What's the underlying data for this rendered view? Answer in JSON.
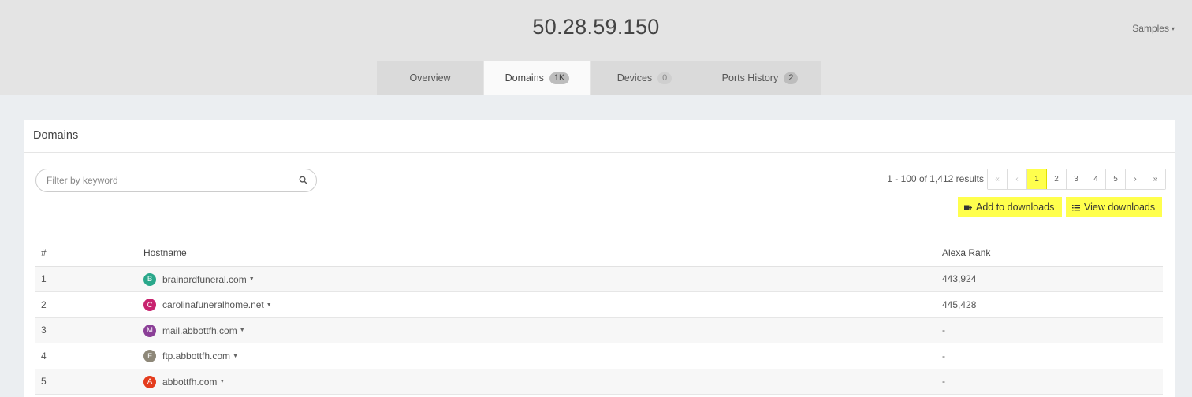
{
  "header": {
    "title": "50.28.59.150",
    "samples_label": "Samples"
  },
  "tabs": [
    {
      "label": "Overview",
      "badge": null
    },
    {
      "label": "Domains",
      "badge": "1K"
    },
    {
      "label": "Devices",
      "badge": "0"
    },
    {
      "label": "Ports History",
      "badge": "2"
    }
  ],
  "panel": {
    "title": "Domains",
    "filter_placeholder": "Filter by keyword",
    "results_text": "1 - 100 of 1,412 results",
    "pager": [
      "«",
      "‹",
      "1",
      "2",
      "3",
      "4",
      "5",
      "›",
      "»"
    ],
    "current_page": "1",
    "add_button": "Add to downloads",
    "view_button": "View downloads"
  },
  "table": {
    "columns": [
      "#",
      "Hostname",
      "Alexa Rank"
    ],
    "rows": [
      {
        "num": "1",
        "letter": "B",
        "color": "#2aa88b",
        "host": "brainardfuneral.com",
        "rank": "443,924"
      },
      {
        "num": "2",
        "letter": "C",
        "color": "#c8236f",
        "host": "carolinafuneralhome.net",
        "rank": "445,428"
      },
      {
        "num": "3",
        "letter": "M",
        "color": "#8b3f97",
        "host": "mail.abbottfh.com",
        "rank": "-"
      },
      {
        "num": "4",
        "letter": "F",
        "color": "#8e8879",
        "host": "ftp.abbottfh.com",
        "rank": "-"
      },
      {
        "num": "5",
        "letter": "A",
        "color": "#e43c1d",
        "host": "abbottfh.com",
        "rank": "-"
      }
    ]
  },
  "icons": {
    "search": "search-icon",
    "dropdown": "caret-down-icon",
    "add_download": "download-add-icon",
    "list": "list-icon"
  }
}
